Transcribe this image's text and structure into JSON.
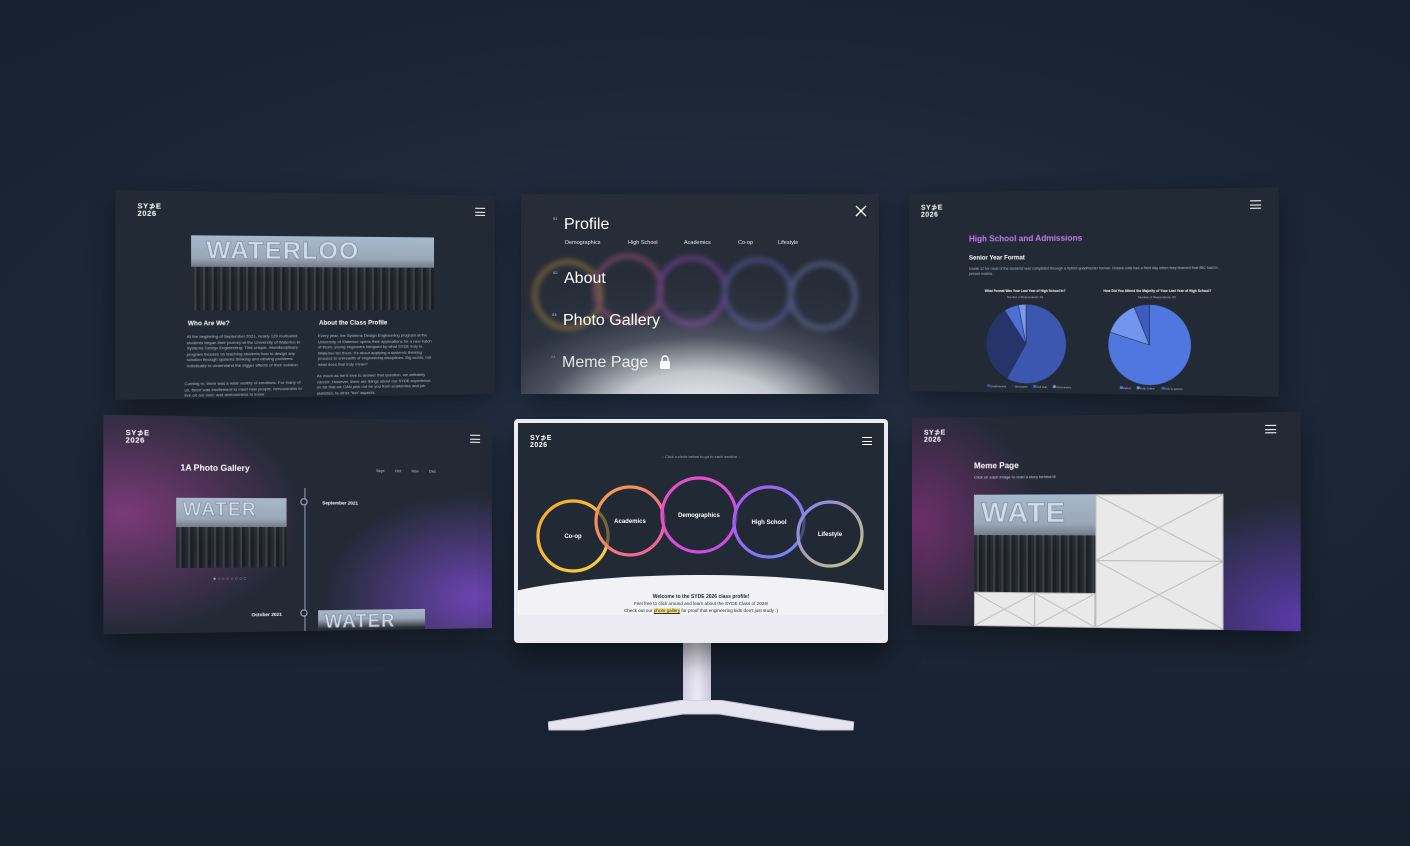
{
  "logo": {
    "line1": "SY⊅E",
    "line2": "2026"
  },
  "screen1": {
    "photo_text": "WATERLOO",
    "who_heading": "Who Are We?",
    "who_text": "At the beginning of September 2021, nearly 120 motivated students began their journey at the University of Waterloo in Systems Design Engineering. This unique, interdisciplinary program focuses on teaching students how to design any solution through systems thinking and viewing problems holistically to understand the bigger effects of their solution.",
    "who_text2": "Coming in, there was a wide variety of emotions. For many of us, there was excitement to meet new people, nervousness to live on our own, and anxiousness to know",
    "about_heading": "About the Class Profile",
    "about_text": "Every year, the Systems Design Engineering program at the University of Waterloo opens their applications for a new batch of fresh, young engineers intrigued by what SYDE truly is. Waterloo tell them, it's about applying a systemic thinking process to a breadth of engineering disciplines. Big words, but what does that truly mean?",
    "about_text2": "As much as we'd love to answer that question, we definitely cannot. However, there are things about our SYDE experience so far that we CAN pick out for you from academics and job statistics, to other \"fun\" aspects"
  },
  "menu": {
    "items": [
      {
        "num": "01",
        "label": "Profile"
      },
      {
        "num": "02",
        "label": "About"
      },
      {
        "num": "03",
        "label": "Photo Gallery"
      },
      {
        "num": "04",
        "label": "Meme Page"
      }
    ],
    "sub_items": [
      "Demographics",
      "High School",
      "Academics",
      "Co-op",
      "Lifestyle"
    ]
  },
  "screen3": {
    "title": "High School and Admissions",
    "subtitle": "Senior Year Format",
    "desc": "Grade 12 for most of the students was completed through a hybrid quadmester format. Ontario kids had a field day when they learned that IBC had in-person exams.",
    "chart1_title": "What Format Was Your Last Year of High School In?",
    "chart1_sub": "Number of Respondents: 63",
    "chart2_title": "How Did You Attend the Majority of Your Last Year of High School?",
    "chart2_sub": "Number of Respondents: 63",
    "legend1": [
      "Quadmesters",
      "Semesters",
      "Full Year",
      "Octomesters"
    ],
    "legend2": [
      "Hybrid",
      "Fully Online",
      "Fully In-person"
    ]
  },
  "chart_data": [
    {
      "type": "pie",
      "title": "What Format Was Your Last Year of High School In?",
      "categories": [
        "Quadmesters",
        "Semesters",
        "Full Year",
        "Octomesters"
      ],
      "values": [
        58,
        33,
        6,
        3
      ],
      "colors": [
        "#3b57b0",
        "#25356b",
        "#4d6fd6",
        "#7b9aee"
      ]
    },
    {
      "type": "pie",
      "title": "How Did You Attend the Majority of Your Last Year of High School?",
      "categories": [
        "Hybrid",
        "Fully Online",
        "Fully In-person"
      ],
      "values": [
        80,
        14,
        6
      ],
      "colors": [
        "#5077e0",
        "#7395f0",
        "#3e5cc0"
      ]
    }
  ],
  "screen4": {
    "title": "1A Photo Gallery",
    "months": [
      "Sept",
      "Oct",
      "Nov",
      "Dec"
    ],
    "entries": [
      "September 2021",
      "October 2021"
    ],
    "photo_text": "WATER"
  },
  "monitor": {
    "hint": "↓ Click a circle below to go to each section ↓",
    "circles": [
      {
        "label": "Co-op",
        "c1": "#f7a531",
        "c2": "#f5d33e"
      },
      {
        "label": "Academics",
        "c1": "#f3a441",
        "c2": "#ee5aa6"
      },
      {
        "label": "Demographics",
        "c1": "#ef4fbe",
        "c2": "#c84cf0"
      },
      {
        "label": "High School",
        "c1": "#b354f2",
        "c2": "#6a8cf5"
      },
      {
        "label": "Lifestyle",
        "c1": "#8b7cf0",
        "c2": "#c9c97d"
      }
    ],
    "welcome_title": "Welcome to the SYDE 2026 class profile!",
    "welcome_line2": "Feel free to click around and learn about the SYDE Class of 2026!",
    "welcome_line3_a": "Check out our",
    "welcome_link": "photo gallery",
    "welcome_line3_b": "for proof that engineering kids don't just study :)"
  },
  "screen6": {
    "title": "Meme Page",
    "subtitle": "Click on each image to read a story behind it!",
    "photo_text": "WATE"
  }
}
